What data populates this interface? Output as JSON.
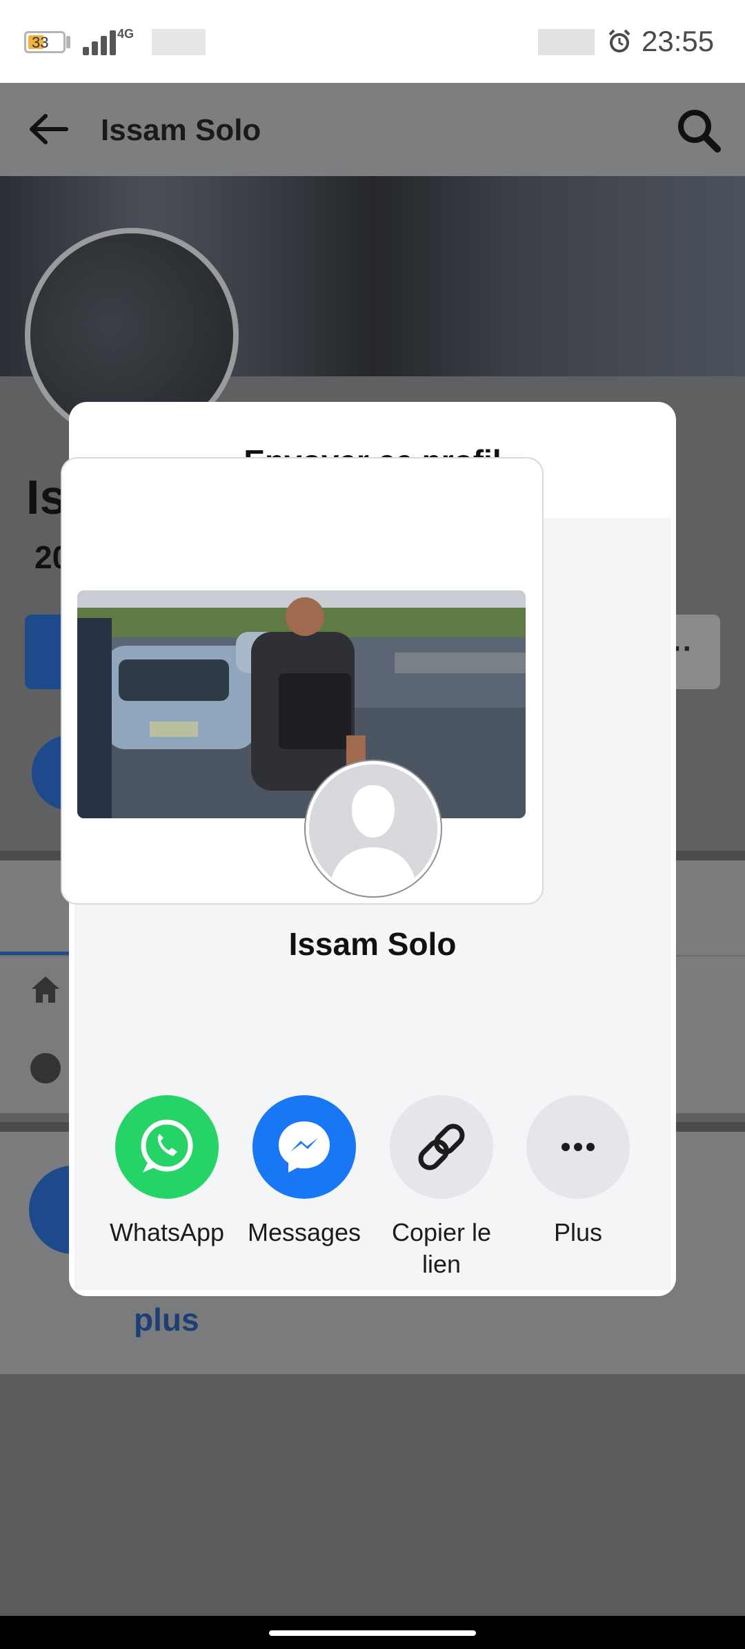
{
  "status_bar": {
    "battery_level": "33",
    "network_type": "4G",
    "time": "23:55"
  },
  "app_bar": {
    "title": "Issam Solo"
  },
  "background_profile": {
    "name_partial": "Is",
    "count_partial": "20",
    "more_link": "plus"
  },
  "dialog": {
    "title": "Envoyer ce profil",
    "card_name": "Issam Solo",
    "share_options": [
      {
        "label": "WhatsApp",
        "icon": "whatsapp-icon",
        "color": "#25d366"
      },
      {
        "label": "Messages",
        "icon": "messenger-icon",
        "color": "#1877f2"
      },
      {
        "label": "Copier le lien",
        "icon": "link-icon",
        "color": "#e4e6eb"
      },
      {
        "label": "Plus",
        "icon": "more-dots-icon",
        "color": "#e4e6eb"
      }
    ]
  },
  "colors": {
    "whatsapp": "#25d366",
    "messenger": "#1877f2",
    "neutral_button": "#e4e6eb",
    "scrim": "#5f6062"
  }
}
